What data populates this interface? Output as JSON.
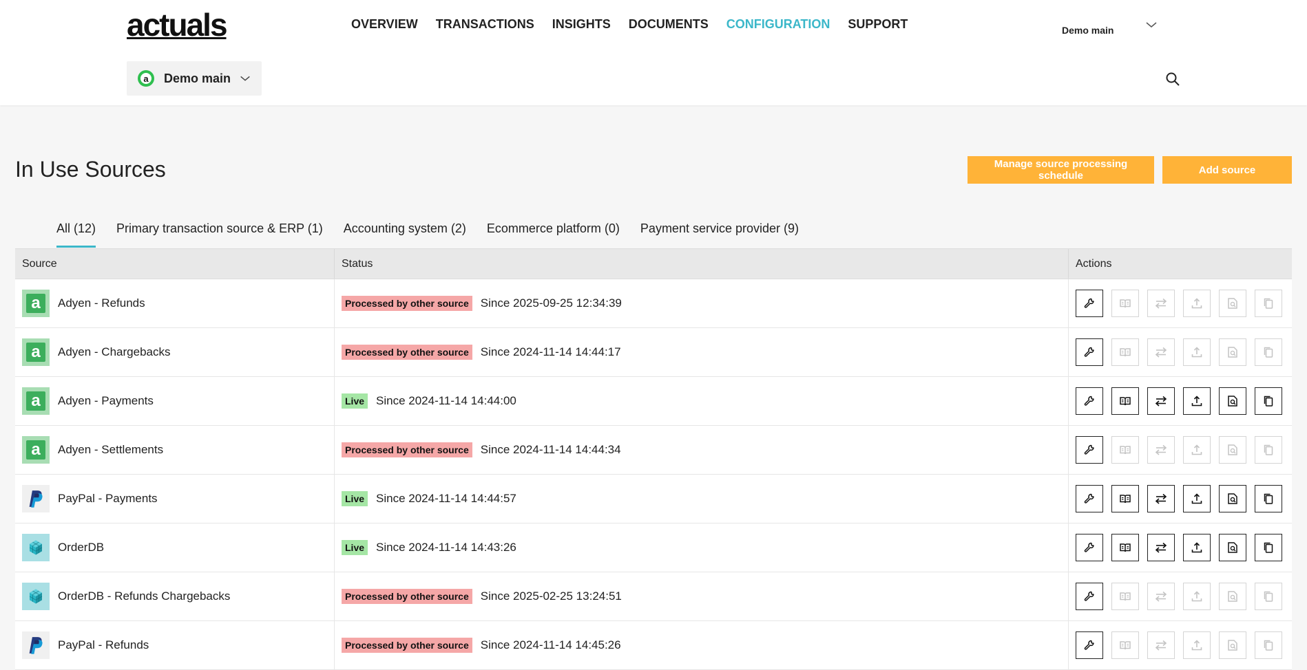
{
  "brand": {
    "logo_text": "actuals"
  },
  "nav": {
    "items": [
      {
        "label": "OVERVIEW",
        "active": false
      },
      {
        "label": "TRANSACTIONS",
        "active": false
      },
      {
        "label": "INSIGHTS",
        "active": false
      },
      {
        "label": "DOCUMENTS",
        "active": false
      },
      {
        "label": "CONFIGURATION",
        "active": true
      },
      {
        "label": "SUPPORT",
        "active": false
      }
    ],
    "active_color": "#3bb7c9"
  },
  "user": {
    "name": "Demo main"
  },
  "tenant": {
    "logo_letter": "a",
    "name": "Demo main"
  },
  "page": {
    "title": "In Use Sources",
    "manage_button": "Manage source processing schedule",
    "add_button": "Add source",
    "button_color": "#ffb338"
  },
  "tabs": [
    {
      "label": "All (12)",
      "active": true
    },
    {
      "label": "Primary transaction source & ERP (1)",
      "active": false
    },
    {
      "label": "Accounting system (2)",
      "active": false
    },
    {
      "label": "Ecommerce platform (0)",
      "active": false
    },
    {
      "label": "Payment service provider (9)",
      "active": false
    }
  ],
  "table": {
    "headers": {
      "source": "Source",
      "status": "Status",
      "actions": "Actions"
    },
    "action_icons": [
      "wrench-icon",
      "book-icon",
      "transfer-icon",
      "upload-icon",
      "document-search-icon",
      "copy-icon"
    ],
    "rows": [
      {
        "logo": "adyen",
        "logo_letter": "a",
        "name": "Adyen - Refunds",
        "status": "Processed by other source",
        "status_type": "other",
        "since": "Since 2025-09-25 12:34:39",
        "actions_enabled": [
          true,
          false,
          false,
          false,
          false,
          false
        ]
      },
      {
        "logo": "adyen",
        "logo_letter": "a",
        "name": "Adyen - Chargebacks",
        "status": "Processed by other source",
        "status_type": "other",
        "since": "Since 2024-11-14 14:44:17",
        "actions_enabled": [
          true,
          false,
          false,
          false,
          false,
          false
        ]
      },
      {
        "logo": "adyen",
        "logo_letter": "a",
        "name": "Adyen - Payments",
        "status": "Live",
        "status_type": "live",
        "since": "Since 2024-11-14 14:44:00",
        "actions_enabled": [
          true,
          true,
          true,
          true,
          true,
          true
        ]
      },
      {
        "logo": "adyen",
        "logo_letter": "a",
        "name": "Adyen - Settlements",
        "status": "Processed by other source",
        "status_type": "other",
        "since": "Since 2024-11-14 14:44:34",
        "actions_enabled": [
          true,
          false,
          false,
          false,
          false,
          false
        ]
      },
      {
        "logo": "paypal",
        "logo_letter": "",
        "name": "PayPal - Payments",
        "status": "Live",
        "status_type": "live",
        "since": "Since 2024-11-14 14:44:57",
        "actions_enabled": [
          true,
          true,
          true,
          true,
          true,
          true
        ]
      },
      {
        "logo": "orderdb",
        "logo_letter": "",
        "name": "OrderDB",
        "status": "Live",
        "status_type": "live",
        "since": "Since 2024-11-14 14:43:26",
        "actions_enabled": [
          true,
          true,
          true,
          true,
          true,
          true
        ]
      },
      {
        "logo": "orderdb",
        "logo_letter": "",
        "name": "OrderDB - Refunds Chargebacks",
        "status": "Processed by other source",
        "status_type": "other",
        "since": "Since 2025-02-25 13:24:51",
        "actions_enabled": [
          true,
          false,
          false,
          false,
          false,
          false
        ]
      },
      {
        "logo": "paypal",
        "logo_letter": "",
        "name": "PayPal - Refunds",
        "status": "Processed by other source",
        "status_type": "other",
        "since": "Since 2024-11-14 14:45:26",
        "actions_enabled": [
          true,
          false,
          false,
          false,
          false,
          false
        ]
      }
    ]
  }
}
